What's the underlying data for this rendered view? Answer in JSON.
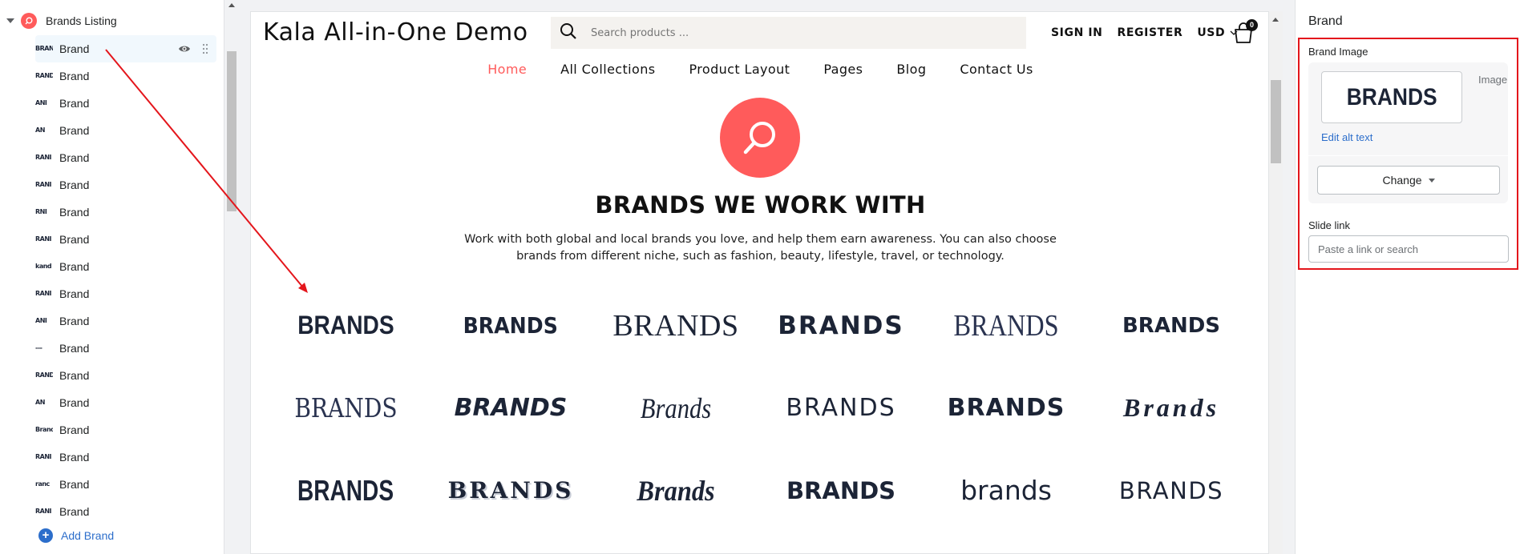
{
  "sidebar": {
    "section_title": "Brands Listing",
    "items": [
      {
        "label": "Brand",
        "thumb": "BRAND"
      },
      {
        "label": "Brand",
        "thumb": "RAND"
      },
      {
        "label": "Brand",
        "thumb": "ANI"
      },
      {
        "label": "Brand",
        "thumb": "AN"
      },
      {
        "label": "Brand",
        "thumb": "RANI"
      },
      {
        "label": "Brand",
        "thumb": "RANI"
      },
      {
        "label": "Brand",
        "thumb": "RNI"
      },
      {
        "label": "Brand",
        "thumb": "RANI"
      },
      {
        "label": "Brand",
        "thumb": "kand"
      },
      {
        "label": "Brand",
        "thumb": "RANI"
      },
      {
        "label": "Brand",
        "thumb": "ANI"
      },
      {
        "label": "Brand",
        "thumb": "---"
      },
      {
        "label": "Brand",
        "thumb": "RAND"
      },
      {
        "label": "Brand",
        "thumb": "AN"
      },
      {
        "label": "Brand",
        "thumb": "Brand"
      },
      {
        "label": "Brand",
        "thumb": "RANI"
      },
      {
        "label": "Brand",
        "thumb": "ranc"
      },
      {
        "label": "Brand",
        "thumb": "RANI"
      }
    ],
    "add_label": "Add Brand"
  },
  "preview": {
    "store_name": "Kala All-in-One Demo",
    "search_placeholder": "Search products ...",
    "sign_in": "SIGN IN",
    "register": "REGISTER",
    "currency": "USD",
    "cart_count": "0",
    "nav": [
      "Home",
      "All Collections",
      "Product Layout",
      "Pages",
      "Blog",
      "Contact Us"
    ],
    "section_title": "BRANDS WE WORK WITH",
    "section_description": "Work with both global and local brands you love, and help them earn awareness. You can also choose brands from different niche, such as fashion, beauty, lifestyle, travel, or technology.",
    "logo_rows": [
      [
        "BRANDS",
        "BRANDS",
        "BRANDS",
        "BRANDS",
        "BRANDS",
        "BRANDS"
      ],
      [
        "BRANDS",
        "BRANDS",
        "Brands",
        "BRANDS",
        "BRANDS",
        "Brands"
      ],
      [
        "BRANDS",
        "BRANDS",
        "Brands",
        "BRANDS",
        "brands",
        "BRANDS"
      ]
    ]
  },
  "right_panel": {
    "title": "Brand",
    "brand_image_label": "Brand Image",
    "image_preview_text": "BRANDS",
    "image_tag": "Image",
    "edit_alt_text": "Edit alt text",
    "change_button": "Change",
    "slide_link_label": "Slide link",
    "slide_link_placeholder": "Paste a link or search",
    "slide_link_value": ""
  },
  "colors": {
    "accent_coral": "#ff5b5b",
    "link_blue": "#2c6ecb",
    "annotation_red": "#e4161c",
    "brand_navy": "#1c2436"
  },
  "icons": {
    "section": "search-circle-icon",
    "visibility": "eye-icon",
    "drag": "drag-handle-icon",
    "add": "plus-circle-icon",
    "search": "search-icon",
    "cart": "shopping-bag-icon",
    "dropdown": "chevron-down-icon"
  }
}
